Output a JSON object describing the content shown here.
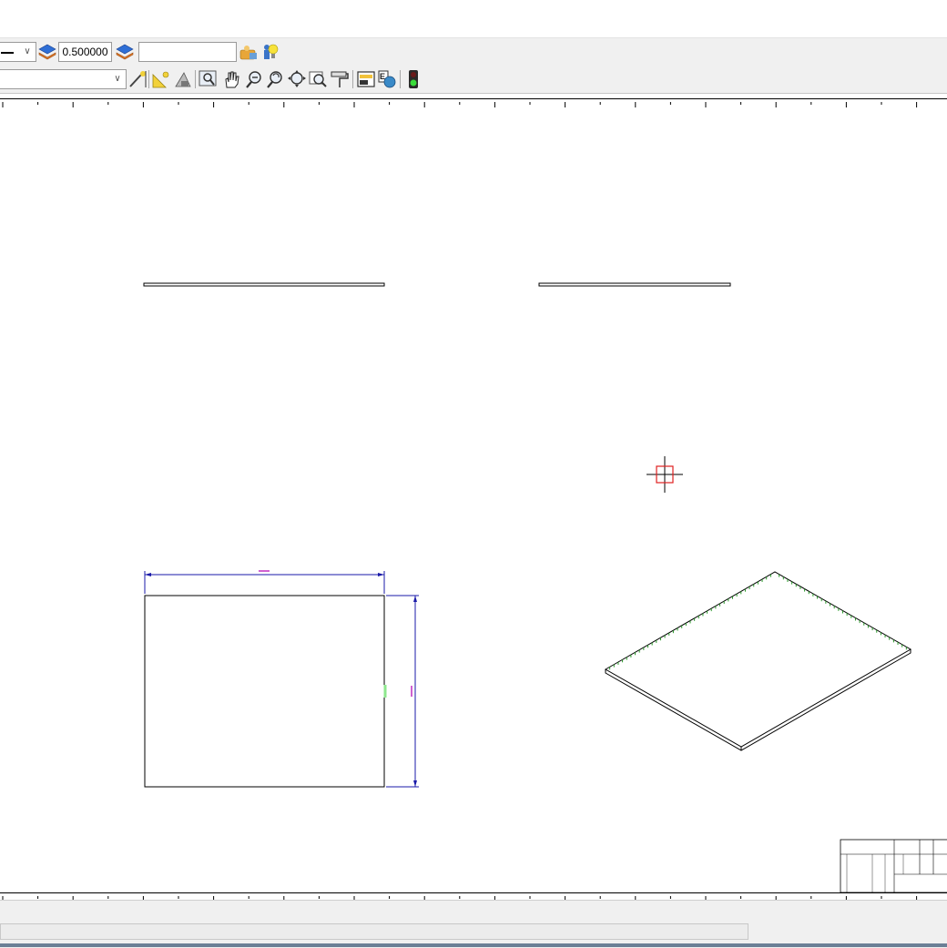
{
  "toolbar": {
    "linetype_value": "",
    "line_weight_value": "0.500000",
    "layer_filter_value": "",
    "view_select_value": ""
  },
  "icons": [
    "layer-stack-icon",
    "layer-stack-icon-2",
    "layer-manager-icon",
    "layer-state-icon",
    "snap-pencil-icon",
    "triangle-ruler-icon",
    "measure-icon",
    "zoom-window-icon",
    "pan-hand-icon",
    "zoom-in-icon",
    "zoom-out-icon",
    "zoom-extents-icon",
    "zoom-all-icon",
    "paint-roller-icon",
    "print-icon",
    "export-icon",
    "traffic-light-icon"
  ],
  "drawing": {
    "dimension_top": "",
    "dimension_right": ""
  },
  "colors": {
    "dimension": "#1a1aa8",
    "dimension_text": "#c02cc0",
    "cursor": "#e02020",
    "hatch": "#2a9a2a"
  }
}
